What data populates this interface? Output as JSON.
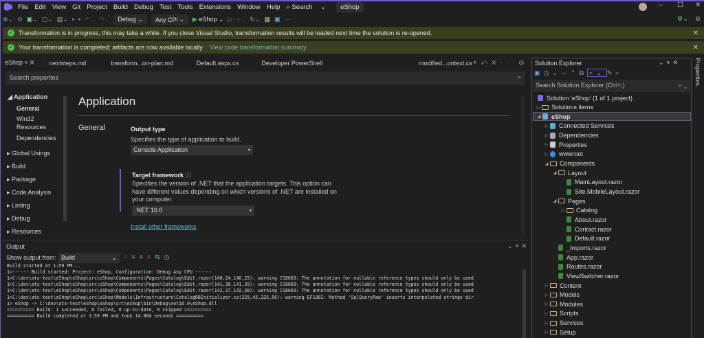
{
  "menu": {
    "items": [
      "File",
      "Edit",
      "View",
      "Git",
      "Project",
      "Build",
      "Debug",
      "Test",
      "Tools",
      "Extensions",
      "Window",
      "Help"
    ],
    "search": "Search",
    "solution_title": "eShop"
  },
  "toolbar": {
    "config": "Debug",
    "platform": "Any CPU",
    "run_target": "eShop"
  },
  "infobars": [
    {
      "message": "Transformation is in progress, this may take a while. If you close Visual Studio, transformation results will be loaded next time the solution is re-opened.",
      "link": ""
    },
    {
      "message": "Your transformation is completed; artifacts are now available locally",
      "link": "View code transformation summary"
    }
  ],
  "tabs": [
    "eShop",
    "nextsteps.md",
    "transform...on-plan.md",
    "Default.aspx.cs",
    "Developer PowerShell",
    "modified...ontext.cs"
  ],
  "properties": {
    "search_placeholder": "Search properties",
    "nav": {
      "application": "Application",
      "general": "General",
      "win32": "Win32",
      "resources_sub": "Resources",
      "dependencies": "Dependencies",
      "items": [
        "Global Usings",
        "Build",
        "Package",
        "Code Analysis",
        "Linting",
        "Debug",
        "Resources"
      ]
    },
    "page_title": "Application",
    "section": "General",
    "output_type": {
      "label": "Output type",
      "desc": "Specifies the type of application to build.",
      "value": "Console Application"
    },
    "target_framework": {
      "label": "Target framework",
      "desc1": "Specifies the version of .NET that the application targets. This option can",
      "desc2": "have different values depending on which versions of .NET are installed on",
      "desc3": "your computer.",
      "value": ".NET 10.0",
      "link": "Install other frameworks"
    }
  },
  "output": {
    "title": "Output",
    "show_from_label": "Show output from:",
    "source": "Build",
    "lines": [
      "Build started at 1:59 PM...",
      "1>------ Build started: Project: eShop, Configuration: Debug Any CPU ------",
      "1>C:\\dev\\atx-test\\eShop\\eShop\\src\\eShop\\Components\\Pages\\Catalog\\Edit.razor(140,24,140,25): warning CS8669: The annotation for nullable reference types should only be used",
      "1>C:\\dev\\atx-test\\eShop\\eShop\\src\\eShop\\Components\\Pages\\Catalog\\Edit.razor(141,38,141,39): warning CS8669: The annotation for nullable reference types should only be used",
      "1>C:\\dev\\atx-test\\eShop\\eShop\\src\\eShop\\Components\\Pages\\Catalog\\Edit.razor(142,37,142,38): warning CS8669: The annotation for nullable reference types should only be used",
      "1>C:\\dev\\atx-test\\eShop\\eShop\\src\\eShop\\Models\\Infrastructure\\CatalogDBInitializer.cs(325,45,325,56): warning EF1002: Method 'SqlQueryRaw' inserts interpolated strings dir",
      "1>  eShop -> C:\\dev\\atx-test\\eShop\\eShop\\src\\eShop\\bin\\Debug\\net10.0\\eShop.dll",
      "========== Build: 1 succeeded, 0 failed, 0 up-to-date, 0 skipped ==========",
      "========== Build completed at 1:59 PM and took 14.004 seconds =========="
    ]
  },
  "solution_explorer": {
    "title": "Solution Explorer",
    "search_placeholder": "Search Solution Explorer (Ctrl+;)",
    "tree": [
      {
        "label": "Solution 'eShop' (1 of 1 project)",
        "level": 0,
        "exp": "",
        "icon": "solution"
      },
      {
        "label": "Solutions items",
        "level": 0,
        "exp": "collapsed",
        "icon": "folder"
      },
      {
        "label": "eShop",
        "level": 0,
        "exp": "expanded",
        "icon": "project",
        "selected": true
      },
      {
        "label": "Connected Services",
        "level": 1,
        "exp": "collapsed",
        "icon": "connected"
      },
      {
        "label": "Dependencies",
        "level": 1,
        "exp": "collapsed",
        "icon": "dependencies"
      },
      {
        "label": "Properties",
        "level": 1,
        "exp": "collapsed",
        "icon": "properties"
      },
      {
        "label": "wwwroot",
        "level": 1,
        "exp": "collapsed",
        "icon": "globe"
      },
      {
        "label": "Components",
        "level": 1,
        "exp": "expanded",
        "icon": "folder"
      },
      {
        "label": "Layout",
        "level": 2,
        "exp": "expanded",
        "icon": "folder"
      },
      {
        "label": "MainLayout.razor",
        "level": 3,
        "exp": "",
        "icon": "razor"
      },
      {
        "label": "Site.MobileLayout.razor",
        "level": 3,
        "exp": "",
        "icon": "razor"
      },
      {
        "label": "Pages",
        "level": 2,
        "exp": "expanded",
        "icon": "folder"
      },
      {
        "label": "Catalog",
        "level": 3,
        "exp": "collapsed",
        "icon": "folder"
      },
      {
        "label": "About.razor",
        "level": 3,
        "exp": "",
        "icon": "razor"
      },
      {
        "label": "Contact.razor",
        "level": 3,
        "exp": "",
        "icon": "razor"
      },
      {
        "label": "Default.razor",
        "level": 3,
        "exp": "",
        "icon": "razor"
      },
      {
        "label": "_Imports.razor",
        "level": 2,
        "exp": "",
        "icon": "razor"
      },
      {
        "label": "App.razor",
        "level": 2,
        "exp": "",
        "icon": "razor"
      },
      {
        "label": "Routes.razor",
        "level": 2,
        "exp": "",
        "icon": "razor"
      },
      {
        "label": "ViewSwitcher.razor",
        "level": 2,
        "exp": "",
        "icon": "razor"
      },
      {
        "label": "Content",
        "level": 1,
        "exp": "collapsed",
        "icon": "folder"
      },
      {
        "label": "Models",
        "level": 1,
        "exp": "collapsed",
        "icon": "folder"
      },
      {
        "label": "Modules",
        "level": 1,
        "exp": "collapsed",
        "icon": "folder"
      },
      {
        "label": "Scripts",
        "level": 1,
        "exp": "collapsed",
        "icon": "folder"
      },
      {
        "label": "Services",
        "level": 1,
        "exp": "collapsed",
        "icon": "folder"
      },
      {
        "label": "Setup",
        "level": 1,
        "exp": "collapsed",
        "icon": "folder"
      }
    ]
  },
  "side_strip": {
    "label": "Properties"
  },
  "colors": {
    "accent": "#6b5fc7",
    "infobar": "#3b3f1f",
    "success": "#4cc25a",
    "link": "#6fb3d2"
  }
}
